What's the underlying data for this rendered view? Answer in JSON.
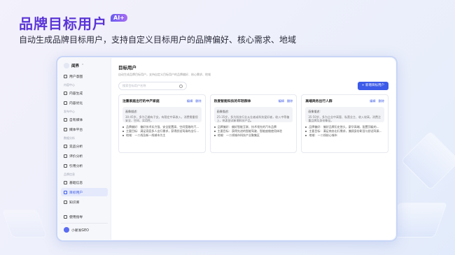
{
  "headline": {
    "title": "品牌目标用户",
    "ai_badge": "AI+",
    "subtitle": "自动生成品牌目标用户，支持自定义目标用户的品牌偏好、核心需求、地域"
  },
  "brand": {
    "name": "闻界",
    "caret": "⌃"
  },
  "sidebar": {
    "top": [
      {
        "label": "用户意图",
        "icon": "user-icon"
      }
    ],
    "sections": [
      {
        "title": "内容中心",
        "items": [
          {
            "label": "内容生成",
            "icon": "doc-icon"
          },
          {
            "label": "内容优化",
            "icon": "edit-icon"
          }
        ]
      },
      {
        "title": "发布中心",
        "items": [
          {
            "label": "自有媒体",
            "icon": "media-icon"
          },
          {
            "label": "媒体平台",
            "icon": "platform-icon"
          }
        ]
      },
      {
        "title": "数据分析",
        "items": [
          {
            "label": "竞品分析",
            "icon": "compare-icon"
          },
          {
            "label": "评价分析",
            "icon": "rating-icon"
          },
          {
            "label": "引用分析",
            "icon": "cite-icon"
          }
        ]
      },
      {
        "title": "品牌信息",
        "items": [
          {
            "label": "基础信息",
            "icon": "info-icon"
          },
          {
            "label": "目标用户",
            "icon": "users-icon",
            "active": true
          },
          {
            "label": "知识库",
            "icon": "book-icon"
          }
        ]
      }
    ],
    "guide": "使用指导",
    "user": "小翟发GEO"
  },
  "main": {
    "title": "目标用户",
    "desc": "自动生成品牌目标用户，支持自定义目标用户的品牌偏好、核心需求、地域",
    "search_placeholder": "搜索目标用户名称",
    "add_button": "+ 新增目标用户",
    "edit_label": "编辑",
    "delete_label": "删除",
    "cards": [
      {
        "name": "注重家庭出行的中产家庭",
        "profile_label": "画像描述:",
        "profile": "30-45岁，多为已婚有子女，有稳定中高收入，消费需重视安全、空间、实用性。",
        "rows": [
          {
            "k": "品牌偏好:",
            "v": "偏好技术实力强、安全配置高、空间宽敞的汽..."
          },
          {
            "k": "主要目标:",
            "v": "满足家庭多人出行需求，获得舒适驾乘的出行..."
          },
          {
            "k": "地域:",
            "v": "一二线及新一线城市为主"
          }
        ]
      },
      {
        "name": "热爱智能科技的年轻群体",
        "profile_label": "画像描述:",
        "profile": "25-35岁，多为科技行业从业者或科技爱好者，收入中等偏上，热衷尝试新潮科技产品。",
        "rows": [
          {
            "k": "品牌偏好:",
            "v": "偏好智能互联、技术领先的汽车品牌"
          },
          {
            "k": "主要目标:",
            "v": "获得先进的智能驾驶、智能座舱使用体验"
          },
          {
            "k": "地域:",
            "v": "一二线城市科技产业聚集区"
          }
        ]
      },
      {
        "name": "高端商务出行人群",
        "profile_label": "画像描述:",
        "profile": "35-50岁，多为企业中高管、私营业主、收入较高，消费注重品牌及身份象征。",
        "rows": [
          {
            "k": "品牌偏好:",
            "v": "偏好品牌历史悠久、豪华高端、配置顶级的..."
          },
          {
            "k": "主要目标:",
            "v": "满足商务出行需求，兼顾身份彰显与舒适驾乘..."
          },
          {
            "k": "地域:",
            "v": "一二线核心城市"
          }
        ]
      }
    ]
  }
}
